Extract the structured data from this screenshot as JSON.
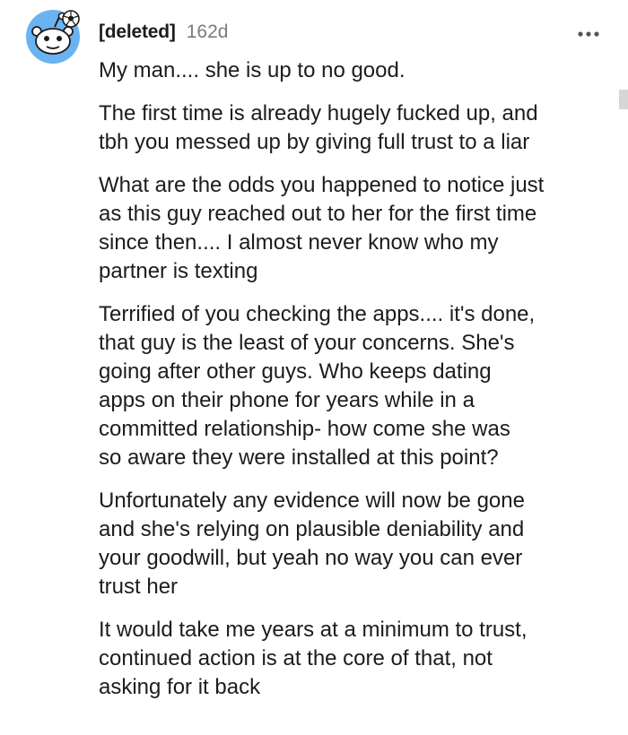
{
  "comment": {
    "username": "[deleted]",
    "age": "162d",
    "avatar_icon": "snoo-avatar-icon",
    "more_icon": "more-options-icon",
    "accent_color": "#6bb3f0",
    "paragraphs": [
      [
        "My man.... she is up to no good."
      ],
      [
        "The first time is already hugely fucked up, and",
        "tbh you messed up by giving full trust to a liar"
      ],
      [
        "What are the odds you happened to notice just",
        "as this guy reached out to her for the first time",
        "since then.... I almost never know who my",
        "partner is texting"
      ],
      [
        "Terrified of you checking the apps.... it's done,",
        "that guy is the least of your concerns. She's",
        "going after other guys. Who keeps dating",
        "apps on their phone for years while in a",
        "committed relationship- how come she was",
        "so aware they were installed at this point?"
      ],
      [
        "Unfortunately any evidence will now be gone",
        "and she's relying on plausible deniability and",
        "your goodwill, but yeah no way you can ever",
        "trust her"
      ],
      [
        "It would take me years at a minimum to trust,",
        "continued action is at the core of that, not",
        "asking for it back"
      ]
    ]
  }
}
